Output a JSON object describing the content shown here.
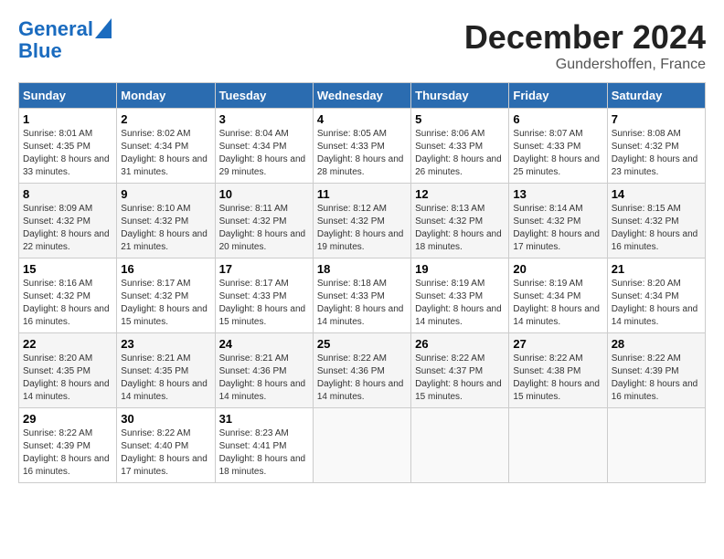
{
  "header": {
    "logo_line1": "General",
    "logo_line2": "Blue",
    "month": "December 2024",
    "location": "Gundershoffen, France"
  },
  "weekdays": [
    "Sunday",
    "Monday",
    "Tuesday",
    "Wednesday",
    "Thursday",
    "Friday",
    "Saturday"
  ],
  "weeks": [
    [
      {
        "day": "1",
        "sunrise": "8:01 AM",
        "sunset": "4:35 PM",
        "daylight": "8 hours and 33 minutes."
      },
      {
        "day": "2",
        "sunrise": "8:02 AM",
        "sunset": "4:34 PM",
        "daylight": "8 hours and 31 minutes."
      },
      {
        "day": "3",
        "sunrise": "8:04 AM",
        "sunset": "4:34 PM",
        "daylight": "8 hours and 29 minutes."
      },
      {
        "day": "4",
        "sunrise": "8:05 AM",
        "sunset": "4:33 PM",
        "daylight": "8 hours and 28 minutes."
      },
      {
        "day": "5",
        "sunrise": "8:06 AM",
        "sunset": "4:33 PM",
        "daylight": "8 hours and 26 minutes."
      },
      {
        "day": "6",
        "sunrise": "8:07 AM",
        "sunset": "4:33 PM",
        "daylight": "8 hours and 25 minutes."
      },
      {
        "day": "7",
        "sunrise": "8:08 AM",
        "sunset": "4:32 PM",
        "daylight": "8 hours and 23 minutes."
      }
    ],
    [
      {
        "day": "8",
        "sunrise": "8:09 AM",
        "sunset": "4:32 PM",
        "daylight": "8 hours and 22 minutes."
      },
      {
        "day": "9",
        "sunrise": "8:10 AM",
        "sunset": "4:32 PM",
        "daylight": "8 hours and 21 minutes."
      },
      {
        "day": "10",
        "sunrise": "8:11 AM",
        "sunset": "4:32 PM",
        "daylight": "8 hours and 20 minutes."
      },
      {
        "day": "11",
        "sunrise": "8:12 AM",
        "sunset": "4:32 PM",
        "daylight": "8 hours and 19 minutes."
      },
      {
        "day": "12",
        "sunrise": "8:13 AM",
        "sunset": "4:32 PM",
        "daylight": "8 hours and 18 minutes."
      },
      {
        "day": "13",
        "sunrise": "8:14 AM",
        "sunset": "4:32 PM",
        "daylight": "8 hours and 17 minutes."
      },
      {
        "day": "14",
        "sunrise": "8:15 AM",
        "sunset": "4:32 PM",
        "daylight": "8 hours and 16 minutes."
      }
    ],
    [
      {
        "day": "15",
        "sunrise": "8:16 AM",
        "sunset": "4:32 PM",
        "daylight": "8 hours and 16 minutes."
      },
      {
        "day": "16",
        "sunrise": "8:17 AM",
        "sunset": "4:32 PM",
        "daylight": "8 hours and 15 minutes."
      },
      {
        "day": "17",
        "sunrise": "8:17 AM",
        "sunset": "4:33 PM",
        "daylight": "8 hours and 15 minutes."
      },
      {
        "day": "18",
        "sunrise": "8:18 AM",
        "sunset": "4:33 PM",
        "daylight": "8 hours and 14 minutes."
      },
      {
        "day": "19",
        "sunrise": "8:19 AM",
        "sunset": "4:33 PM",
        "daylight": "8 hours and 14 minutes."
      },
      {
        "day": "20",
        "sunrise": "8:19 AM",
        "sunset": "4:34 PM",
        "daylight": "8 hours and 14 minutes."
      },
      {
        "day": "21",
        "sunrise": "8:20 AM",
        "sunset": "4:34 PM",
        "daylight": "8 hours and 14 minutes."
      }
    ],
    [
      {
        "day": "22",
        "sunrise": "8:20 AM",
        "sunset": "4:35 PM",
        "daylight": "8 hours and 14 minutes."
      },
      {
        "day": "23",
        "sunrise": "8:21 AM",
        "sunset": "4:35 PM",
        "daylight": "8 hours and 14 minutes."
      },
      {
        "day": "24",
        "sunrise": "8:21 AM",
        "sunset": "4:36 PM",
        "daylight": "8 hours and 14 minutes."
      },
      {
        "day": "25",
        "sunrise": "8:22 AM",
        "sunset": "4:36 PM",
        "daylight": "8 hours and 14 minutes."
      },
      {
        "day": "26",
        "sunrise": "8:22 AM",
        "sunset": "4:37 PM",
        "daylight": "8 hours and 15 minutes."
      },
      {
        "day": "27",
        "sunrise": "8:22 AM",
        "sunset": "4:38 PM",
        "daylight": "8 hours and 15 minutes."
      },
      {
        "day": "28",
        "sunrise": "8:22 AM",
        "sunset": "4:39 PM",
        "daylight": "8 hours and 16 minutes."
      }
    ],
    [
      {
        "day": "29",
        "sunrise": "8:22 AM",
        "sunset": "4:39 PM",
        "daylight": "8 hours and 16 minutes."
      },
      {
        "day": "30",
        "sunrise": "8:22 AM",
        "sunset": "4:40 PM",
        "daylight": "8 hours and 17 minutes."
      },
      {
        "day": "31",
        "sunrise": "8:23 AM",
        "sunset": "4:41 PM",
        "daylight": "8 hours and 18 minutes."
      },
      null,
      null,
      null,
      null
    ]
  ]
}
